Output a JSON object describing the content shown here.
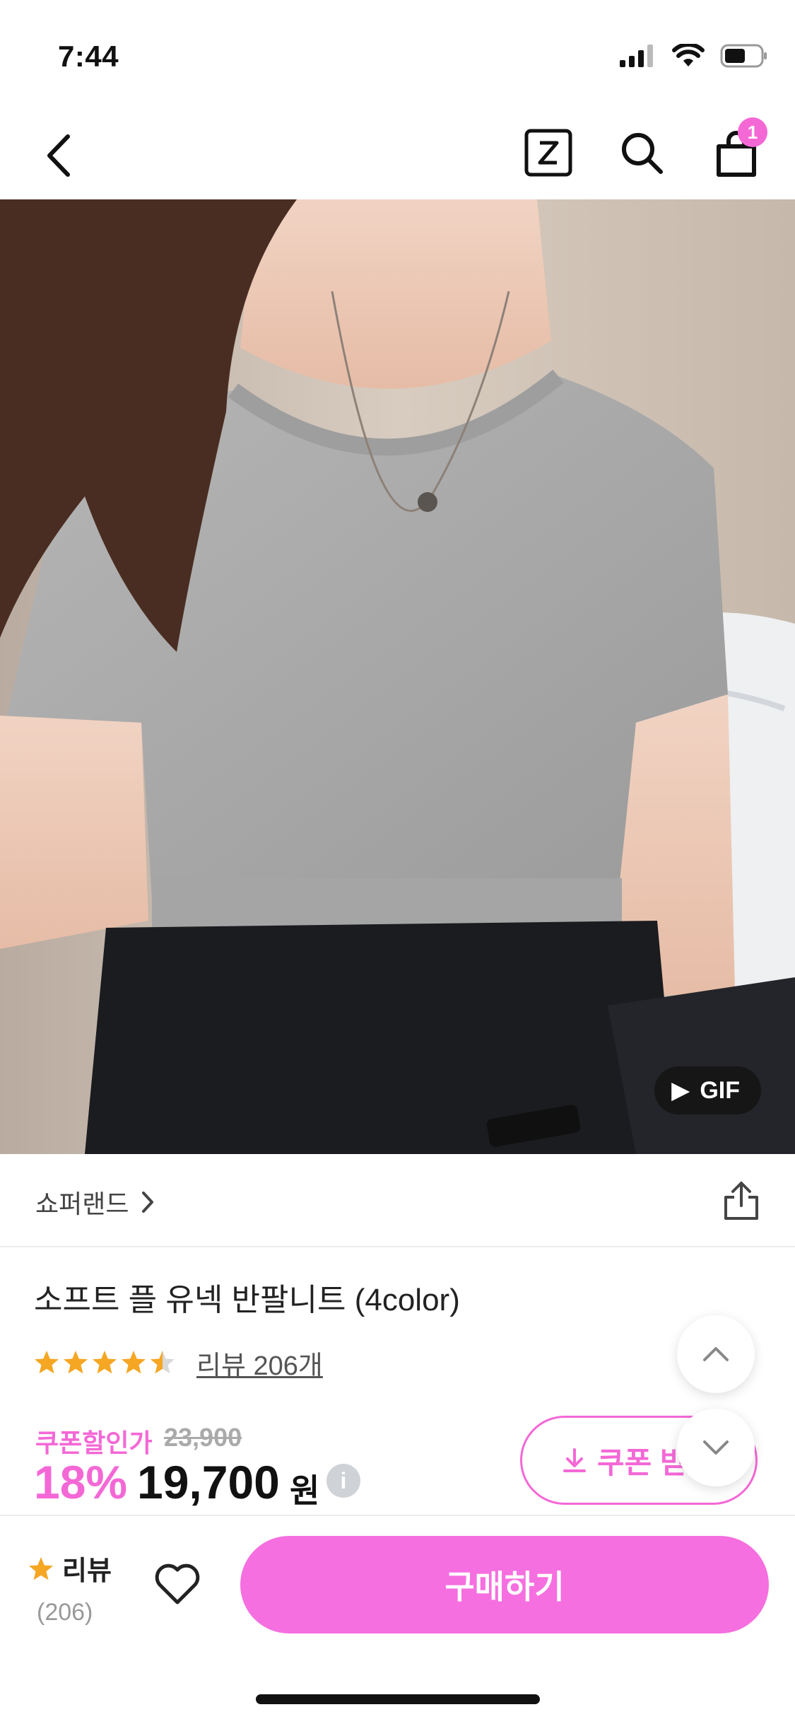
{
  "status_bar": {
    "time": "7:44"
  },
  "header": {
    "cart_count": "1"
  },
  "hero": {
    "badge": "GIF"
  },
  "seller": {
    "name": "쇼퍼랜드"
  },
  "product": {
    "title": "소프트 플 유넥 반팔니트 (4color)",
    "rating_stars": 4.5,
    "review_link": "리뷰 206개",
    "coupon_label": "쿠폰할인가",
    "original_price": "23,900",
    "discount": "18%",
    "price": "19,700",
    "currency": "원",
    "info": "i",
    "coupon_button": "쿠폰 받"
  },
  "bottom_bar": {
    "review_label": "리뷰",
    "review_count": "(206)",
    "buy_label": "구매하기"
  },
  "colors": {
    "accent": "#f468d6",
    "buy": "#f56fe0",
    "star": "#f5a623"
  }
}
